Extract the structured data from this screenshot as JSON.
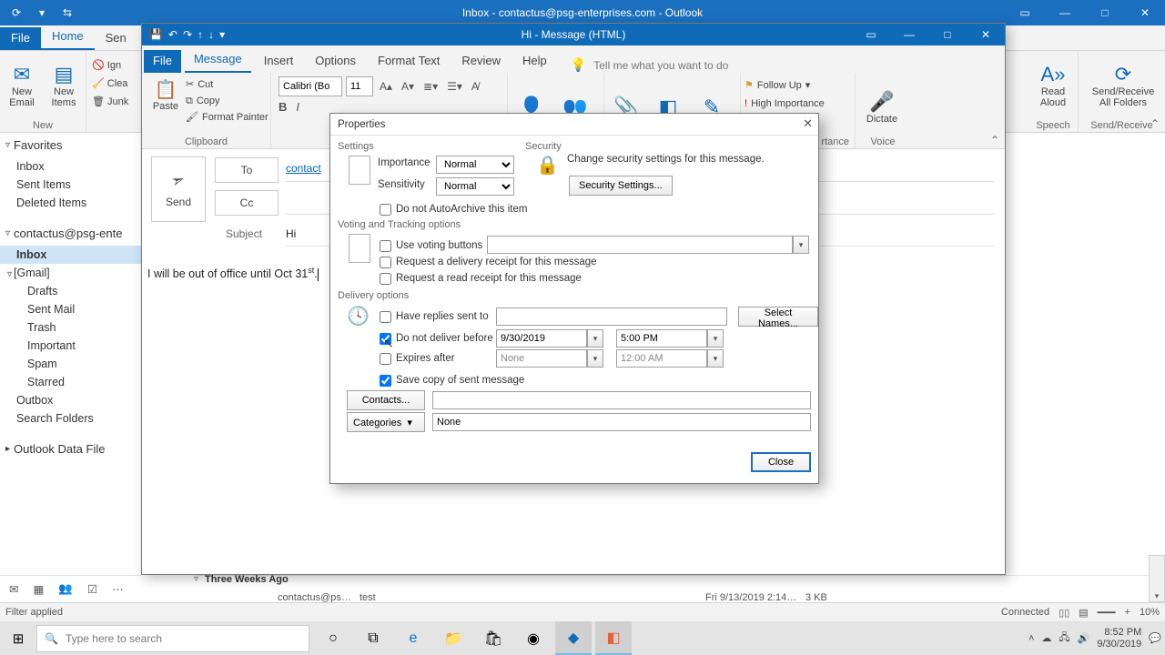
{
  "main_window": {
    "title": "Inbox - contactus@psg-enterprises.com - Outlook",
    "tabs": {
      "file": "File",
      "home": "Home",
      "send": "Sen"
    },
    "ribbon_right": {
      "read_aloud": "Read\nAloud",
      "send_receive": "Send/Receive\nAll Folders",
      "speech_grp": "Speech",
      "sr_grp": "Send/Receive"
    },
    "ribbon_left": {
      "new_email": "New\nEmail",
      "new_items": "New\nItems",
      "new_grp": "New",
      "ignore": "Ign",
      "clean": "Clea",
      "junk": "Junk"
    }
  },
  "leftnav": {
    "favorites": "Favorites",
    "fav_items": [
      "Inbox",
      "Sent Items",
      "Deleted Items"
    ],
    "account": "contactus@psg-ente",
    "acct_items": [
      {
        "t": "Inbox",
        "bold": true,
        "ind": false
      },
      {
        "t": "[Gmail]",
        "bold": false,
        "ind": false,
        "chev": true
      },
      {
        "t": "Drafts",
        "bold": false,
        "ind": true
      },
      {
        "t": "Sent Mail",
        "bold": false,
        "ind": true
      },
      {
        "t": "Trash",
        "bold": false,
        "ind": true
      },
      {
        "t": "Important",
        "bold": false,
        "ind": true
      },
      {
        "t": "Spam",
        "bold": false,
        "ind": true
      },
      {
        "t": "Starred",
        "bold": false,
        "ind": true
      },
      {
        "t": "Outbox",
        "bold": false,
        "ind": false
      },
      {
        "t": "Search Folders",
        "bold": false,
        "ind": false
      }
    ],
    "datafile": "Outlook Data File"
  },
  "msg_window": {
    "title": "Hi - Message (HTML)",
    "tabs": {
      "file": "File",
      "message": "Message",
      "insert": "Insert",
      "options": "Options",
      "format": "Format Text",
      "review": "Review",
      "help": "Help",
      "tell": "Tell me what you want to do"
    },
    "clipboard": {
      "cut": "Cut",
      "copy": "Copy",
      "fp": "Format Painter",
      "paste": "Paste",
      "grp": "Clipboard"
    },
    "font": {
      "name": "Calibri (Bo",
      "size": "11"
    },
    "tags": {
      "follow": "Follow Up",
      "hi": "High Importance",
      "grp": "rtance"
    },
    "voice": {
      "dictate": "Dictate",
      "grp": "Voice"
    },
    "compose": {
      "send": "Send",
      "to": "To",
      "cc": "Cc",
      "subject_lbl": "Subject",
      "to_val": "contact",
      "subject_val": "Hi",
      "body": "I will be out of office until Oct 31"
    }
  },
  "properties": {
    "title": "Properties",
    "settings": {
      "hdr": "Settings",
      "importance": "Importance",
      "importance_val": "Normal",
      "sensitivity": "Sensitivity",
      "sensitivity_val": "Normal",
      "autoarchive": "Do not AutoArchive this item"
    },
    "security": {
      "hdr": "Security",
      "msg": "Change security settings for this message.",
      "btn": "Security Settings..."
    },
    "voting": {
      "hdr": "Voting and Tracking options",
      "use": "Use voting buttons",
      "delivery": "Request a delivery receipt for this message",
      "read": "Request a read receipt for this message"
    },
    "delivery": {
      "hdr": "Delivery options",
      "replies": "Have replies sent to",
      "selectnames": "Select Names...",
      "notbefore": "Do not deliver before",
      "notbefore_date": "9/30/2019",
      "notbefore_time": "5:00 PM",
      "expires": "Expires after",
      "expires_date": "None",
      "expires_time": "12:00 AM",
      "savecopy": "Save copy of sent message",
      "contacts": "Contacts...",
      "categories": "Categories",
      "categories_val": "None"
    },
    "close": "Close"
  },
  "inbox_frag": {
    "group": "Three Weeks Ago",
    "from": "contactus@ps…",
    "subj": "test",
    "date": "Fri 9/13/2019 2:14…",
    "size": "3 KB"
  },
  "statusbar": {
    "left": "Filter applied",
    "connected": "Connected",
    "zoom": "10%"
  },
  "taskbar": {
    "search_placeholder": "Type here to search",
    "time": "8:52 PM",
    "date": "9/30/2019"
  }
}
